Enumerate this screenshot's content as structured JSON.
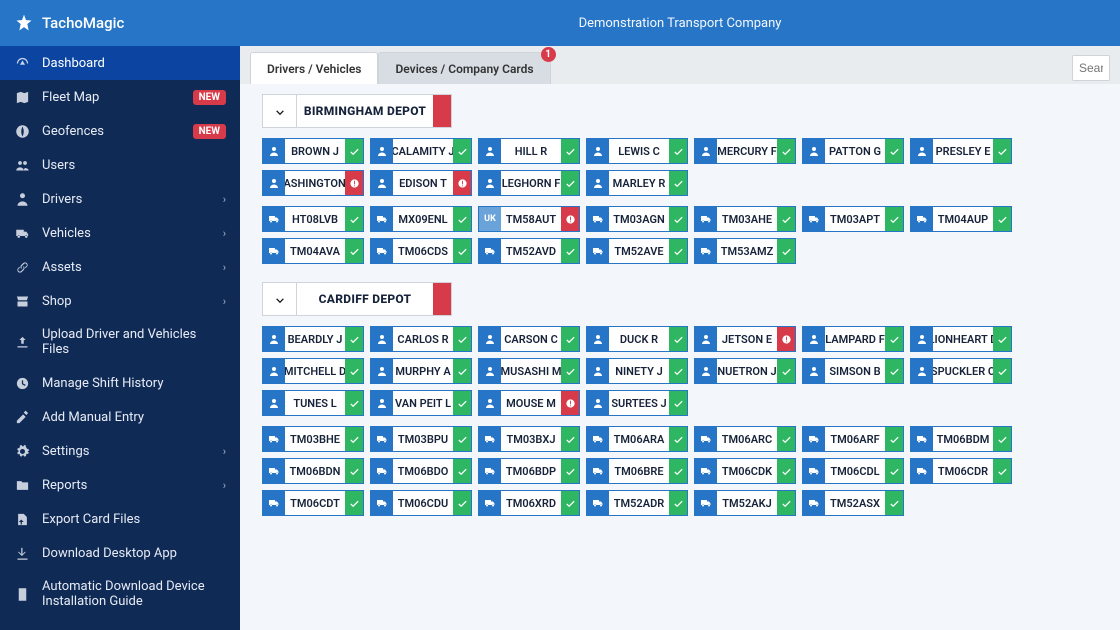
{
  "brand": "TachoMagic",
  "company": "Demonstration Transport Company",
  "sidebar": {
    "items": [
      {
        "label": "Dashboard",
        "icon": "gauge",
        "active": true
      },
      {
        "label": "Fleet Map",
        "icon": "map",
        "badge": "NEW"
      },
      {
        "label": "Geofences",
        "icon": "globe",
        "badge": "NEW"
      },
      {
        "label": "Users",
        "icon": "users"
      },
      {
        "label": "Drivers",
        "icon": "driver",
        "chev": true
      },
      {
        "label": "Vehicles",
        "icon": "truck",
        "chev": true
      },
      {
        "label": "Assets",
        "icon": "link",
        "chev": true
      },
      {
        "label": "Shop",
        "icon": "shop",
        "chev": true
      },
      {
        "label": "Upload Driver and Vehicles Files",
        "icon": "upload"
      },
      {
        "label": "Manage Shift History",
        "icon": "history"
      },
      {
        "label": "Add Manual Entry",
        "icon": "edit"
      },
      {
        "label": "Settings",
        "icon": "gears",
        "chev": true
      },
      {
        "label": "Reports",
        "icon": "folder",
        "chev": true
      },
      {
        "label": "Export Card Files",
        "icon": "export"
      },
      {
        "label": "Download Desktop App",
        "icon": "download"
      },
      {
        "label": "Automatic Download Device Installation Guide",
        "icon": "device"
      }
    ]
  },
  "tabs": [
    {
      "label": "Drivers / Vehicles",
      "active": true
    },
    {
      "label": "Devices / Company Cards",
      "badge": "1"
    }
  ],
  "search_placeholder": "Search",
  "depots": [
    {
      "title": "BIRMINGHAM DEPOT",
      "drivers": [
        {
          "name": "BROWN J",
          "ok": true
        },
        {
          "name": "CALAMITY J",
          "ok": true
        },
        {
          "name": "HILL R",
          "ok": true
        },
        {
          "name": "LEWIS C",
          "ok": true
        },
        {
          "name": "MERCURY F",
          "ok": true
        },
        {
          "name": "PATTON G",
          "ok": true
        },
        {
          "name": "PRESLEY E",
          "ok": true
        },
        {
          "name": "WASHINGTON G",
          "ok": false
        },
        {
          "name": "EDISON T",
          "ok": false
        },
        {
          "name": "LEGHORN F",
          "ok": true
        },
        {
          "name": "MARLEY R",
          "ok": true
        }
      ],
      "vehicles": [
        {
          "name": "HT08LVB",
          "ok": true
        },
        {
          "name": "MX09ENL",
          "ok": true
        },
        {
          "name": "TM58AUT",
          "ok": false,
          "uk": true
        },
        {
          "name": "TM03AGN",
          "ok": true
        },
        {
          "name": "TM03AHE",
          "ok": true
        },
        {
          "name": "TM03APT",
          "ok": true
        },
        {
          "name": "TM04AUP",
          "ok": true
        },
        {
          "name": "TM04AVA",
          "ok": true
        },
        {
          "name": "TM06CDS",
          "ok": true
        },
        {
          "name": "TM52AVD",
          "ok": true
        },
        {
          "name": "TM52AVE",
          "ok": true
        },
        {
          "name": "TM53AMZ",
          "ok": true
        }
      ]
    },
    {
      "title": "CARDIFF DEPOT",
      "drivers": [
        {
          "name": "BEARDLY J",
          "ok": true
        },
        {
          "name": "CARLOS R",
          "ok": true
        },
        {
          "name": "CARSON C",
          "ok": true
        },
        {
          "name": "DUCK R",
          "ok": true
        },
        {
          "name": "JETSON E",
          "ok": false
        },
        {
          "name": "LAMPARD F",
          "ok": true
        },
        {
          "name": "LIONHEART D",
          "ok": true
        },
        {
          "name": "MITCHELL D",
          "ok": true
        },
        {
          "name": "MURPHY A",
          "ok": true
        },
        {
          "name": "MUSASHI M",
          "ok": true
        },
        {
          "name": "NINETY J",
          "ok": true
        },
        {
          "name": "NUETRON J",
          "ok": true
        },
        {
          "name": "SIMSON B",
          "ok": true
        },
        {
          "name": "SPUCKLER C",
          "ok": true
        },
        {
          "name": "TUNES L",
          "ok": true
        },
        {
          "name": "VAN PEIT L",
          "ok": true
        },
        {
          "name": "MOUSE M",
          "ok": false
        },
        {
          "name": "SURTEES J",
          "ok": true
        }
      ],
      "vehicles": [
        {
          "name": "TM03BHE",
          "ok": true
        },
        {
          "name": "TM03BPU",
          "ok": true
        },
        {
          "name": "TM03BXJ",
          "ok": true
        },
        {
          "name": "TM06ARA",
          "ok": true
        },
        {
          "name": "TM06ARC",
          "ok": true
        },
        {
          "name": "TM06ARF",
          "ok": true
        },
        {
          "name": "TM06BDM",
          "ok": true
        },
        {
          "name": "TM06BDN",
          "ok": true
        },
        {
          "name": "TM06BDO",
          "ok": true
        },
        {
          "name": "TM06BDP",
          "ok": true
        },
        {
          "name": "TM06BRE",
          "ok": true
        },
        {
          "name": "TM06CDK",
          "ok": true
        },
        {
          "name": "TM06CDL",
          "ok": true
        },
        {
          "name": "TM06CDR",
          "ok": true
        },
        {
          "name": "TM06CDT",
          "ok": true
        },
        {
          "name": "TM06CDU",
          "ok": true
        },
        {
          "name": "TM06XRD",
          "ok": true
        },
        {
          "name": "TM52ADR",
          "ok": true
        },
        {
          "name": "TM52AKJ",
          "ok": true
        },
        {
          "name": "TM52ASX",
          "ok": true
        }
      ]
    }
  ],
  "flag": "UK"
}
